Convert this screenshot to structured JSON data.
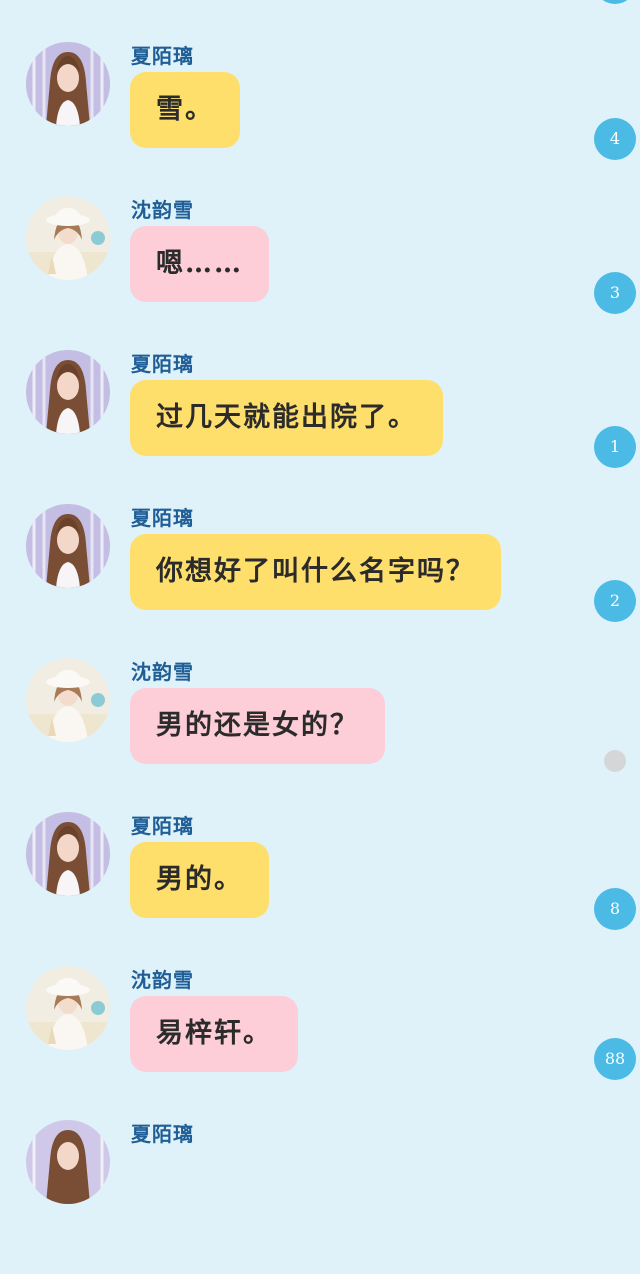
{
  "messages": [
    {
      "sender": "夏陌璃",
      "text": "雪。",
      "color": "yellow",
      "avatar": "girl-long-hair-avatar"
    },
    {
      "sender": "沈韵雪",
      "text": "嗯……",
      "color": "pink",
      "avatar": "girl-white-hat-avatar"
    },
    {
      "sender": "夏陌璃",
      "text": "过几天就能出院了。",
      "color": "yellow",
      "avatar": "girl-long-hair-avatar"
    },
    {
      "sender": "夏陌璃",
      "text": "你想好了叫什么名字吗？",
      "color": "yellow",
      "avatar": "girl-long-hair-avatar"
    },
    {
      "sender": "沈韵雪",
      "text": "男的还是女的？",
      "color": "pink",
      "avatar": "girl-white-hat-avatar"
    },
    {
      "sender": "夏陌璃",
      "text": "男的。",
      "color": "yellow",
      "avatar": "girl-long-hair-avatar"
    },
    {
      "sender": "沈韵雪",
      "text": "易梓轩。",
      "color": "pink",
      "avatar": "girl-white-hat-avatar"
    },
    {
      "sender": "夏陌璃",
      "text": "",
      "color": "yellow",
      "avatar": "girl-long-hair-avatar"
    }
  ],
  "side_badges": [
    "4",
    "3",
    "1",
    "2",
    "",
    "8",
    "88"
  ],
  "colors": {
    "background": "#dff2fa",
    "bubble_yellow": "#ffdf6c",
    "bubble_pink": "#fdcdd8",
    "name_text": "#1f5e96",
    "badge": "#4bbbe6",
    "badge_inactive": "#d4d6d8"
  }
}
